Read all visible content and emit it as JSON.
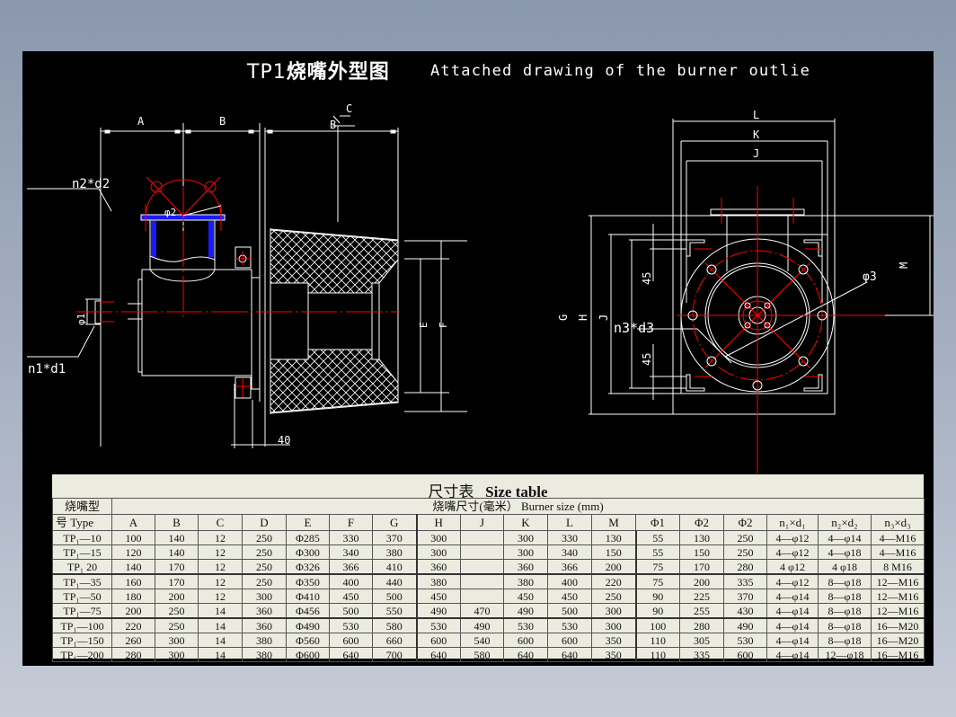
{
  "drawing": {
    "title_code": "TP1",
    "title_cn": "烧嘴外型图",
    "title_en": "Attached drawing of the burner outlie",
    "side_view_labels": {
      "A": "A",
      "B": "B",
      "B2": "B",
      "C": "C",
      "E": "E",
      "F": "F",
      "n2d2": "n2*d2",
      "phi2": "φ2",
      "phi1": "φ1",
      "n1d1": "n1*d1",
      "dim40": "40"
    },
    "front_view_labels": {
      "L": "L",
      "K": "K",
      "J": "J",
      "M": "M",
      "G": "G",
      "H": "H",
      "J2": "J",
      "dim45_top": "45",
      "dim45_bottom": "45",
      "n3d3": "n3*d3",
      "phi3": "φ3"
    },
    "colors": {
      "background": "#000000",
      "lines": "#ffffff",
      "centerlines": "#ff0000",
      "flange_hatch": "#1a1aff"
    }
  },
  "size_table": {
    "title_cn": "尺寸表",
    "title_en": "Size table",
    "type_header_line1": "烧嘴型",
    "type_header_line2": "号  Type",
    "group_header": "烧嘴尺寸(毫米）  Burner size (mm)",
    "columns": [
      "A",
      "B",
      "C",
      "D",
      "E",
      "F",
      "G",
      "H",
      "J",
      "K",
      "L",
      "M",
      "Φ1",
      "Φ2",
      "Φ2",
      "n₁×d₁",
      "n₂×d₂",
      "n₃×d₃"
    ],
    "rows": [
      {
        "type": "TP₁—10",
        "values": [
          "100",
          "140",
          "12",
          "250",
          "Φ285",
          "330",
          "370",
          "300",
          "",
          "300",
          "330",
          "130",
          "55",
          "130",
          "250",
          "4—φ12",
          "4—φ14",
          "4—M16"
        ]
      },
      {
        "type": "TP₁—15",
        "values": [
          "120",
          "140",
          "12",
          "250",
          "Φ300",
          "340",
          "380",
          "300",
          "",
          "300",
          "340",
          "150",
          "55",
          "150",
          "250",
          "4—φ12",
          "4—φ18",
          "4—M16"
        ]
      },
      {
        "type": "TP₁  20",
        "values": [
          "140",
          "170",
          "12",
          "250",
          "Φ326",
          "366",
          "410",
          "360",
          "",
          "360",
          "366",
          "200",
          "75",
          "170",
          "280",
          "4  φ12",
          "4  φ18",
          "8  M16"
        ]
      },
      {
        "type": "TP₁—35",
        "values": [
          "160",
          "170",
          "12",
          "250",
          "Φ350",
          "400",
          "440",
          "380",
          "",
          "380",
          "400",
          "220",
          "75",
          "200",
          "335",
          "4—φ12",
          "8—φ18",
          "12—M16"
        ]
      },
      {
        "type": "TP₁—50",
        "values": [
          "180",
          "200",
          "12",
          "300",
          "Φ410",
          "450",
          "500",
          "450",
          "",
          "450",
          "450",
          "250",
          "90",
          "225",
          "370",
          "4—φ14",
          "8—φ18",
          "12—M16"
        ]
      },
      {
        "type": "TP₁—75",
        "values": [
          "200",
          "250",
          "14",
          "360",
          "Φ456",
          "500",
          "550",
          "490",
          "470",
          "490",
          "500",
          "300",
          "90",
          "255",
          "430",
          "4—φ14",
          "8—φ18",
          "12—M16"
        ]
      },
      {
        "type": "TP₁—100",
        "values": [
          "220",
          "250",
          "14",
          "360",
          "Φ490",
          "530",
          "580",
          "530",
          "490",
          "530",
          "530",
          "300",
          "100",
          "280",
          "490",
          "4—φ14",
          "8—φ18",
          "16—M20"
        ]
      },
      {
        "type": "TP₁—150",
        "values": [
          "260",
          "300",
          "14",
          "380",
          "Φ560",
          "600",
          "660",
          "600",
          "540",
          "600",
          "600",
          "350",
          "110",
          "305",
          "530",
          "4—φ14",
          "8—φ18",
          "16—M20"
        ]
      },
      {
        "type": "TP₁—200",
        "values": [
          "280",
          "300",
          "14",
          "380",
          "Φ600",
          "640",
          "700",
          "640",
          "580",
          "640",
          "640",
          "350",
          "110",
          "335",
          "600",
          "4—φ14",
          "12—φ18",
          "16—M16"
        ]
      }
    ]
  }
}
